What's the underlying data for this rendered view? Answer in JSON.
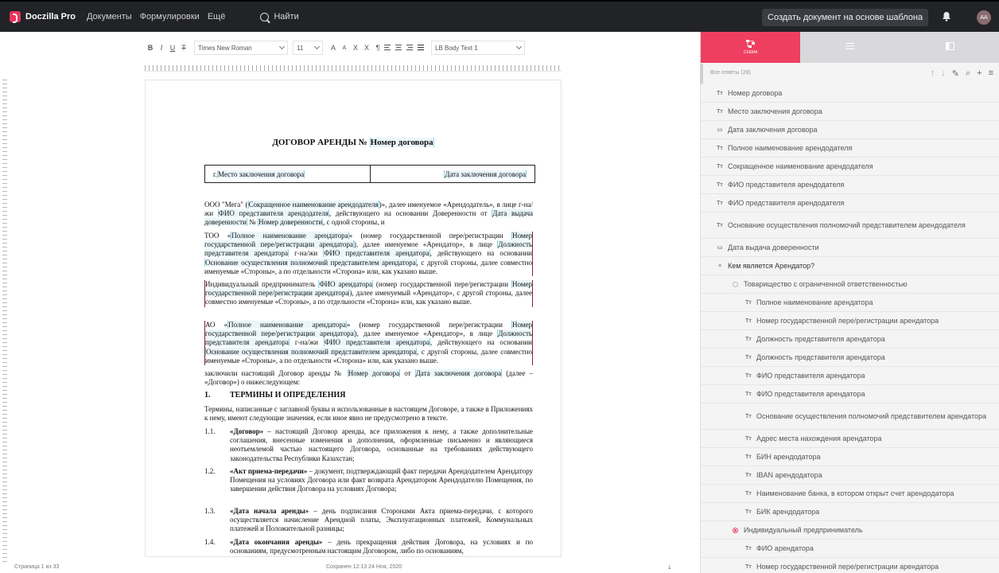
{
  "app": {
    "brand": "Doczilla Pro",
    "nav": [
      "Документы",
      "Формулировки",
      "Ещё"
    ],
    "search_label": "Найти",
    "create_button": "Создать документ на основе шаблона",
    "avatar_initials": "AA"
  },
  "toolbar": {
    "bold": "B",
    "italic": "I",
    "underline": "U",
    "strike": "T",
    "font": "Times New Roman",
    "size": "11",
    "grow": "A",
    "shrink": "A",
    "subscript": "X",
    "superscript": "X",
    "pilcrow": "¶",
    "style": "LB Body Text 1"
  },
  "document": {
    "title_prefix": "ДОГОВОР АРЕНДЫ № ",
    "title_field": "Номер договора",
    "place_prefix": "г. ",
    "place_field": "Место заключения договора",
    "date_field": "Дата заключения договора",
    "p1": {
      "a": "ООО \"Мега\" (",
      "f1": "Сокращенное наименование арендодателя",
      "b": ")», далее именуемое «Арендодатель», в лице г-на/жи ",
      "f2": "ФИО представителя арендодателя",
      "c": ", действующего на основании Доверенности от ",
      "f3": "Дата выдача доверенности",
      "d": " № ",
      "f4": "Номер доверенности",
      "e": ", с одной стороны, и"
    },
    "p2": {
      "a": "ТОО «",
      "f1": "Полное наименование арендатора",
      "b": "» (номер государственной пере/регистрации ",
      "f2": "Номер государственной пере/регистрации арендатора",
      "c": "), далее именуемое «Арендатор», в лице ",
      "f3": "Должность представителя арендатора",
      "d": " г-на/жи ",
      "f4": "ФИО представителя арендатора",
      "e": ", действующего на основании ",
      "f5": "Основание осуществления полномочий представителем арендатора",
      "g": ", с другой стороны, далее совместно именуемые «Стороны», а по отдельности «Сторона» или, как указано выше."
    },
    "p3": {
      "a": "Индивидуальный предприниматель ",
      "f1": "ФИО арендатора",
      "b": " (номер государственной пере/регистрации ",
      "f2": "Номер государственной пере/регистрации арендатора",
      "c": "), далее именуемый «Арендатор», с другой стороны, далее совместно именуемые «Стороны», а по отдельности «Сторона» или, как указано выше."
    },
    "p4": {
      "a": "АО «",
      "f1": "Полное наименование арендатора",
      "b": "» (номер государственной пере/регистрации ",
      "f2": "Номер государственной пере/регистрации арендатора",
      "c": "), далее именуемое «Арендатор», в лице ",
      "f3": "Должность представителя арендатора",
      "d": " г-на/жи ",
      "f4": "ФИО представителя арендатора",
      "e": ", действующего на основании ",
      "f5": "Основание осуществления полномочий представителем арендатора",
      "g": ", с другой стороны, далее совместно именуемые «Стороны», а по отдельности «Сторона» или, как указано выше."
    },
    "p5": {
      "a": "заключили настоящий Договор аренды № ",
      "f1": "Номер договора",
      "b": " от ",
      "f2": "Дата заключения договора",
      "c": " (далее – «Договор») о нижеследующем:"
    },
    "section1_num": "1.",
    "section1_title": "ТЕРМИНЫ И ОПРЕДЕЛЕНИЯ",
    "section1_intro": "Термины, написанные с заглавной буквы и использованные в настоящем Договоре, а также в Приложениях к нему, имеют следующие значения, если иное явно не предусмотрено в тексте.",
    "items": [
      {
        "num": "1.1.",
        "term": "«Договор»",
        "text": " – настоящий Договор аренды, все приложения к нему, а также дополнительные соглашения, внесенные изменения и дополнения, оформленные письменно и являющиеся неотъемлемой частью настоящего Договора, основанные на требованиях действующего законодательства Республики Казахстан;"
      },
      {
        "num": "1.2.",
        "term": "«Акт приема-передачи»",
        "text": " – документ, подтверждающий факт передачи Арендодателем Арендатору Помещения на условиях Договора или факт возврата Арендатором Арендодателю Помещения, по завершении действия Договора на условиях Договора;"
      },
      {
        "num": "1.3.",
        "term": "«Дата начала аренды»",
        "text": " – день подписания Сторонами Акта приема-передачи, с которого осуществляется начисление Арендной платы, Эксплуатационных платежей, Коммунальных платежей и Положительной разницы;"
      },
      {
        "num": "1.4.",
        "term": "«Дата окончания аренды»",
        "text": " – день прекращения действия Договора, на условиях и по основаниям, предусмотренным настоящим Договором, либо по основаниям,"
      }
    ]
  },
  "status": {
    "page": "Страница 1 из 33",
    "saved": "Сохранен 12:13 24 Ноя, 2020"
  },
  "panel": {
    "tabs": [
      "СХЕМА",
      "",
      ""
    ],
    "filter": "Все ответы (28)",
    "items": [
      {
        "icon": "Тт",
        "label": "Номер договора"
      },
      {
        "icon": "Тт",
        "label": "Место заключения договора"
      },
      {
        "icon": "▭",
        "label": "Дата заключения договора"
      },
      {
        "icon": "Тт",
        "label": "Полное наименование арендодателя"
      },
      {
        "icon": "Тт",
        "label": "Сокращенное наименование арендодателя"
      },
      {
        "icon": "Тт",
        "label": "ФИО представителя арендодателя"
      },
      {
        "icon": "Тт",
        "label": "ФИО представителя арендодателя"
      },
      {
        "icon": "Тт",
        "label": "Основание осуществления полномочий представителем арендодателя"
      },
      {
        "icon": "▭",
        "label": "Дата выдача доверенности"
      },
      {
        "icon": "≡",
        "label": "Кем является Арендатор?"
      },
      {
        "icon": "",
        "label": "Товарищество с ограниченной ответственностью"
      },
      {
        "icon": "Тт",
        "label": "Полное наименование арендатора"
      },
      {
        "icon": "Тт",
        "label": "Номер государственной пере/регистрации арендатора"
      },
      {
        "icon": "Тт",
        "label": "Должность представителя арендатора"
      },
      {
        "icon": "Тт",
        "label": "Должность представителя арендатора"
      },
      {
        "icon": "Тт",
        "label": "ФИО представителя арендатора"
      },
      {
        "icon": "Тт",
        "label": "ФИО представителя арендатора"
      },
      {
        "icon": "Тт",
        "label": "Основание осуществления полномочий представителем арендатора"
      },
      {
        "icon": "Тт",
        "label": "Адрес места нахождения арендатора"
      },
      {
        "icon": "Тт",
        "label": "БИН арендодатора"
      },
      {
        "icon": "Тт",
        "label": "IBAN арендодатора"
      },
      {
        "icon": "Тт",
        "label": "Наименование банка, в котором открыт счет арендодатора"
      },
      {
        "icon": "Тт",
        "label": "БИК арендодатора"
      },
      {
        "icon": "",
        "label": "Индивидуальный предприниматель"
      },
      {
        "icon": "Тт",
        "label": "ФИО арендатора"
      },
      {
        "icon": "Тт",
        "label": "Номер государственной пере/регистрации арендатора"
      }
    ]
  }
}
